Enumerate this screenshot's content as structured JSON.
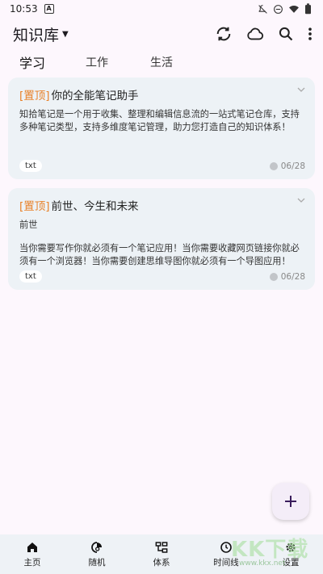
{
  "status_bar": {
    "time": "10:53",
    "a_icon": "A"
  },
  "app_bar": {
    "title": "知识库",
    "icons": [
      "sync-icon",
      "cloud-icon",
      "search-icon",
      "more-vert-icon"
    ]
  },
  "tabs": [
    {
      "label": "学习",
      "active": true
    },
    {
      "label": "工作",
      "active": false
    },
    {
      "label": "生活",
      "active": false
    }
  ],
  "notes": [
    {
      "pin": "[置顶]",
      "title": "你的全能笔记助手",
      "body": [
        "知拾笔记是一个用于收集、整理和编辑信息流的一站式笔记仓库，支持多种笔记类型，支持多维度笔记管理，助力您打造自己的知识体系！"
      ],
      "tag": "txt",
      "date": "06/28"
    },
    {
      "pin": "[置顶]",
      "title": "前世、今生和未来",
      "body": [
        "前世",
        "当你需要写作你就必须有一个笔记应用！当你需要收藏网页链接你就必须有一个浏览器！当你需要创建思维导图你就必须有一个导图应用！"
      ],
      "tag": "txt",
      "date": "06/28"
    }
  ],
  "fab": {
    "label": "+"
  },
  "bottom_nav": [
    {
      "label": "主页",
      "icon": "home-icon"
    },
    {
      "label": "随机",
      "icon": "random-icon"
    },
    {
      "label": "体系",
      "icon": "hierarchy-icon"
    },
    {
      "label": "时间线",
      "icon": "clock-icon"
    },
    {
      "label": "设置",
      "icon": "gear-icon"
    }
  ],
  "watermark": {
    "text": "KK下载",
    "sub": "www.kkx.net"
  },
  "colors": {
    "accent": "#e8822a",
    "card_bg": "#edf2f6",
    "page_bg": "#fdf7fd"
  }
}
